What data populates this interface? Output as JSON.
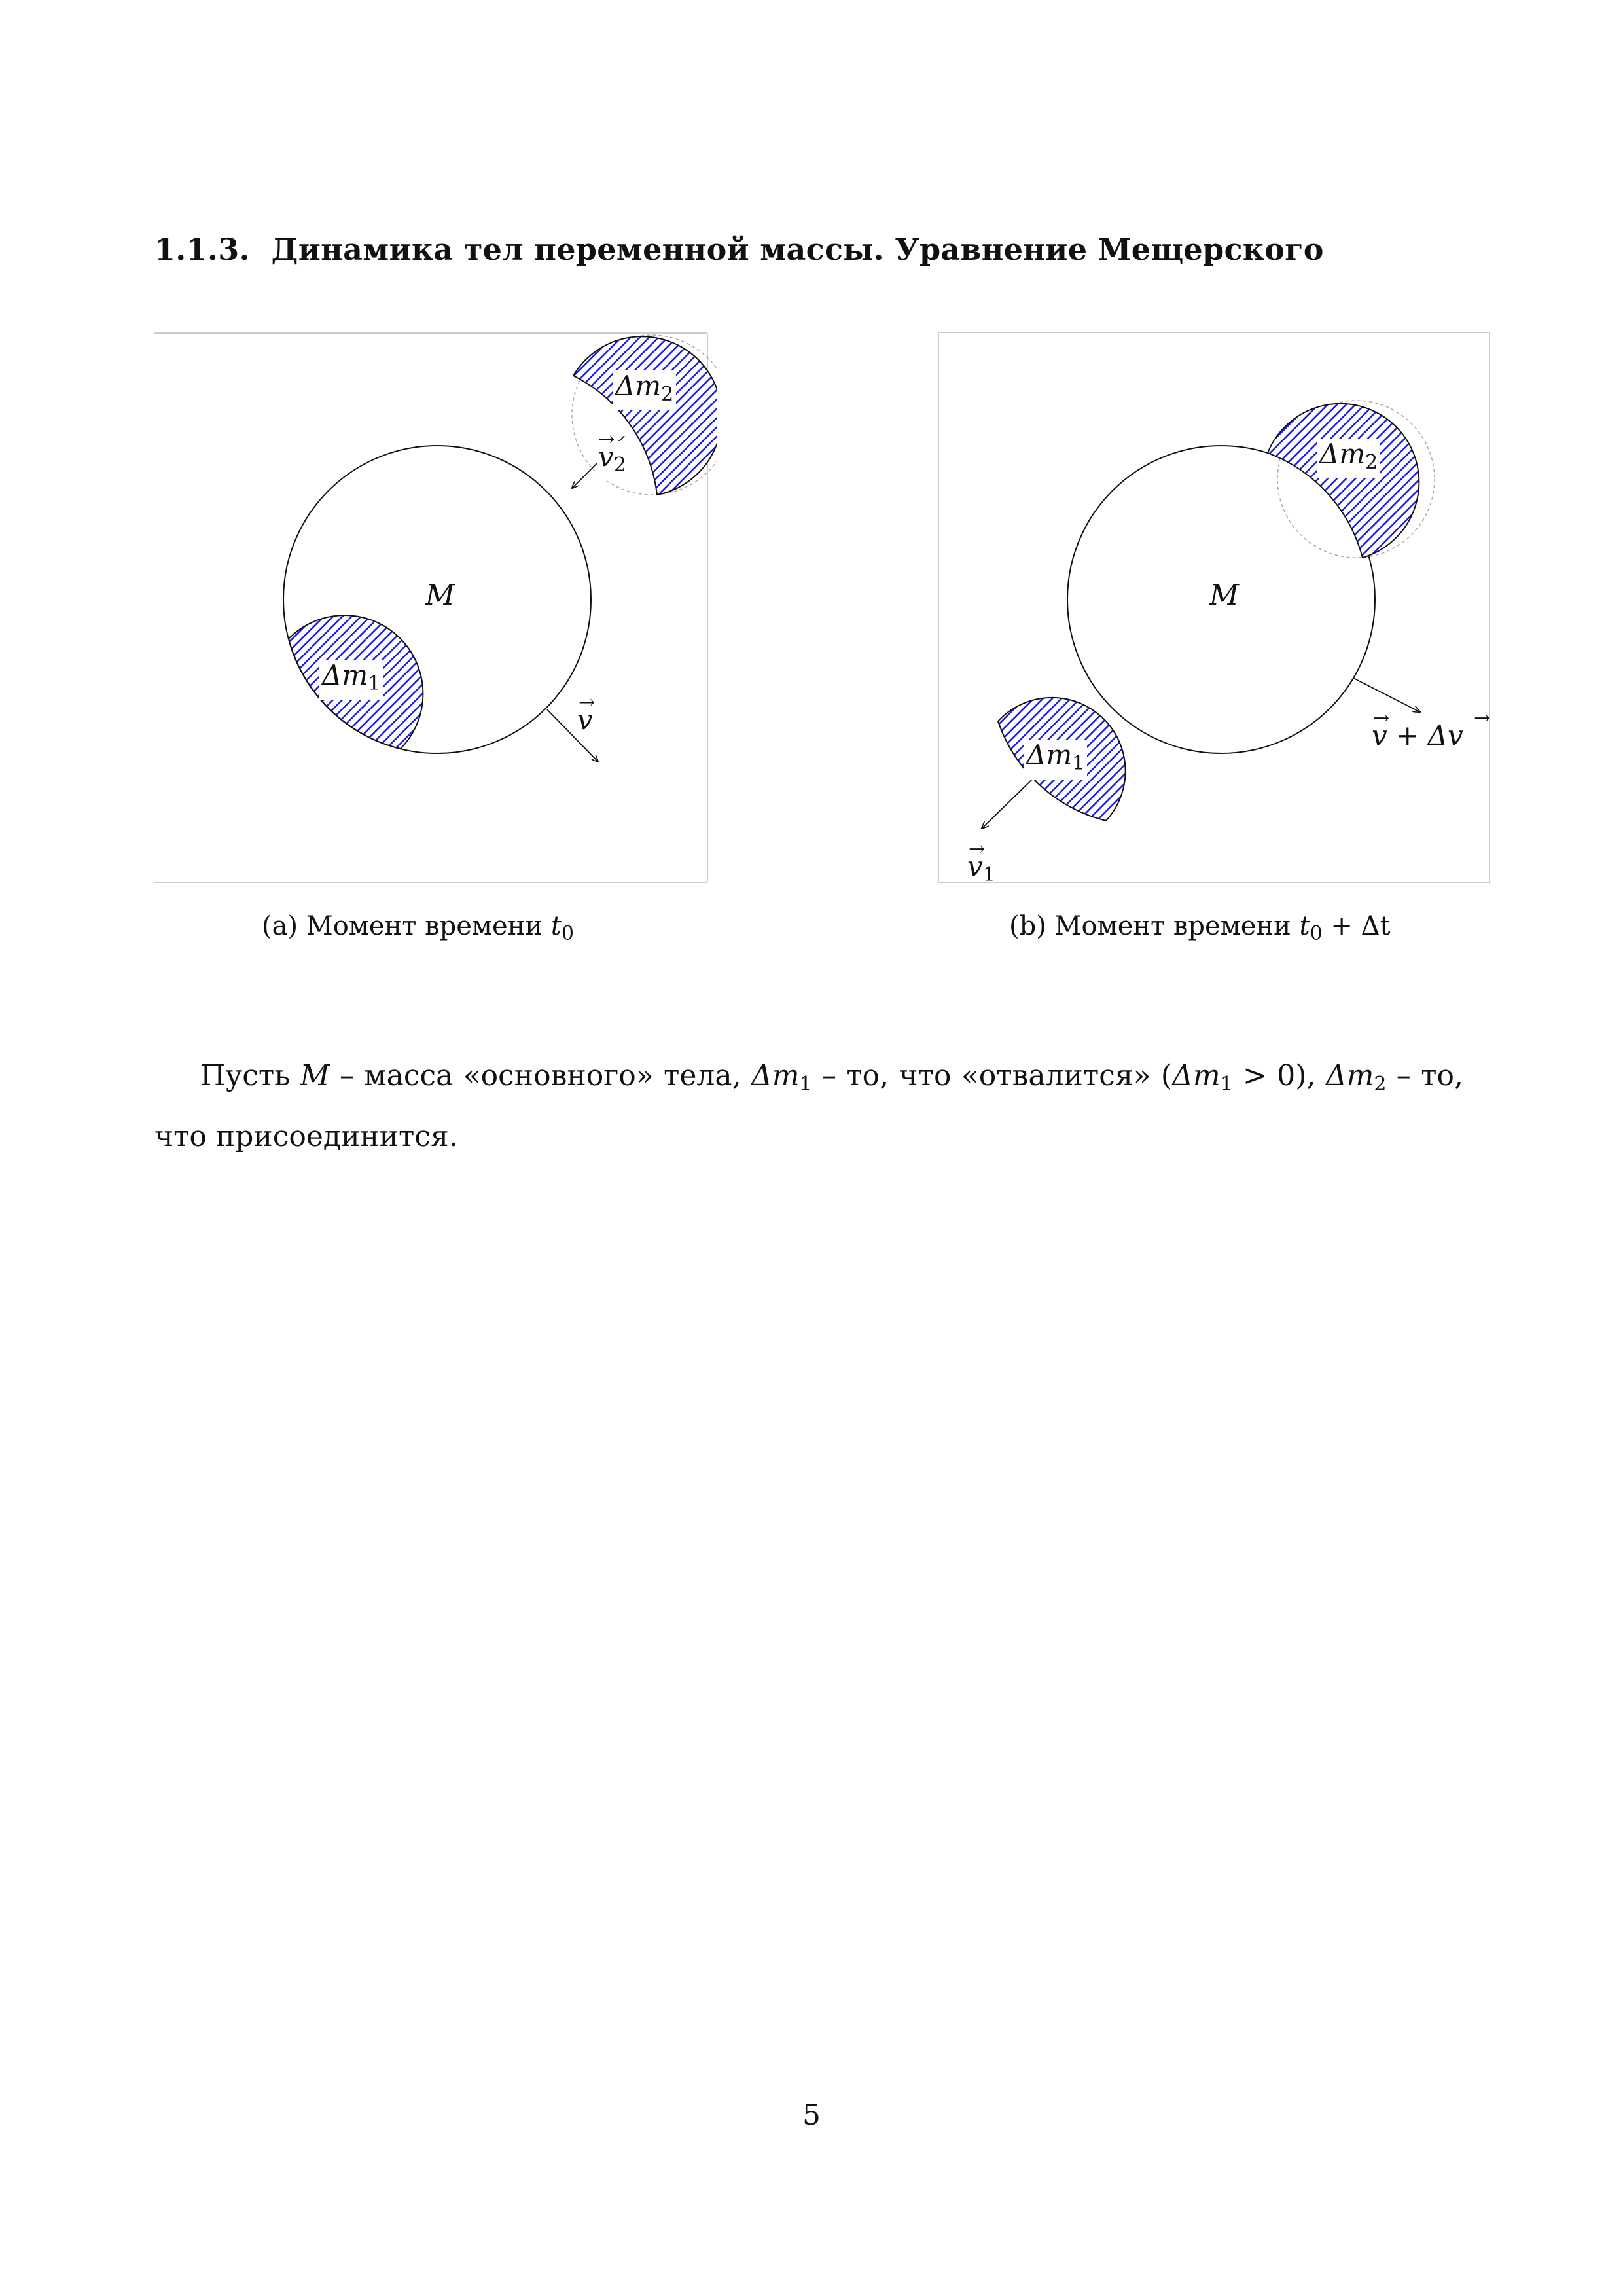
{
  "section": {
    "number": "1.1.3.",
    "title": "Динамика тел переменной массы. Уравнение Мещерского"
  },
  "figure_a": {
    "caption_tag": "(a)",
    "caption_text": "Момент времени",
    "caption_math": "t",
    "caption_math_sub": "0",
    "labels": {
      "body": "M",
      "dm1": "Δm",
      "dm1_sub": "1",
      "dm2": "Δm",
      "dm2_sub": "2",
      "v": "v",
      "v2": "v",
      "v2_sub": "2"
    }
  },
  "figure_b": {
    "caption_tag": "(b)",
    "caption_text": "Момент времени",
    "caption_math": "t",
    "caption_math_sub": "0",
    "caption_math_rest": " + Δt",
    "labels": {
      "body": "M",
      "dm1": "Δm",
      "dm1_sub": "1",
      "dm2": "Δm",
      "dm2_sub": "2",
      "v_plus": "v + Δv",
      "v1": "v",
      "v1_sub": "1"
    }
  },
  "paragraph": {
    "p1": "Пусть ",
    "m_sym": "M",
    "p2": " – масса «основного» тела, ",
    "dm1": "Δm",
    "dm1_sub": "1",
    "p3": " – то, что «отвалится» (",
    "dm1b": "Δm",
    "dm1b_sub": "1",
    "p4": " > 0), ",
    "dm2": "Δm",
    "dm2_sub": "2",
    "p5": " – то, что присоединится."
  },
  "page_number": "5",
  "colors": {
    "hatch": "#1a1ae6",
    "outline": "#111111",
    "frame": "#cccccc"
  }
}
